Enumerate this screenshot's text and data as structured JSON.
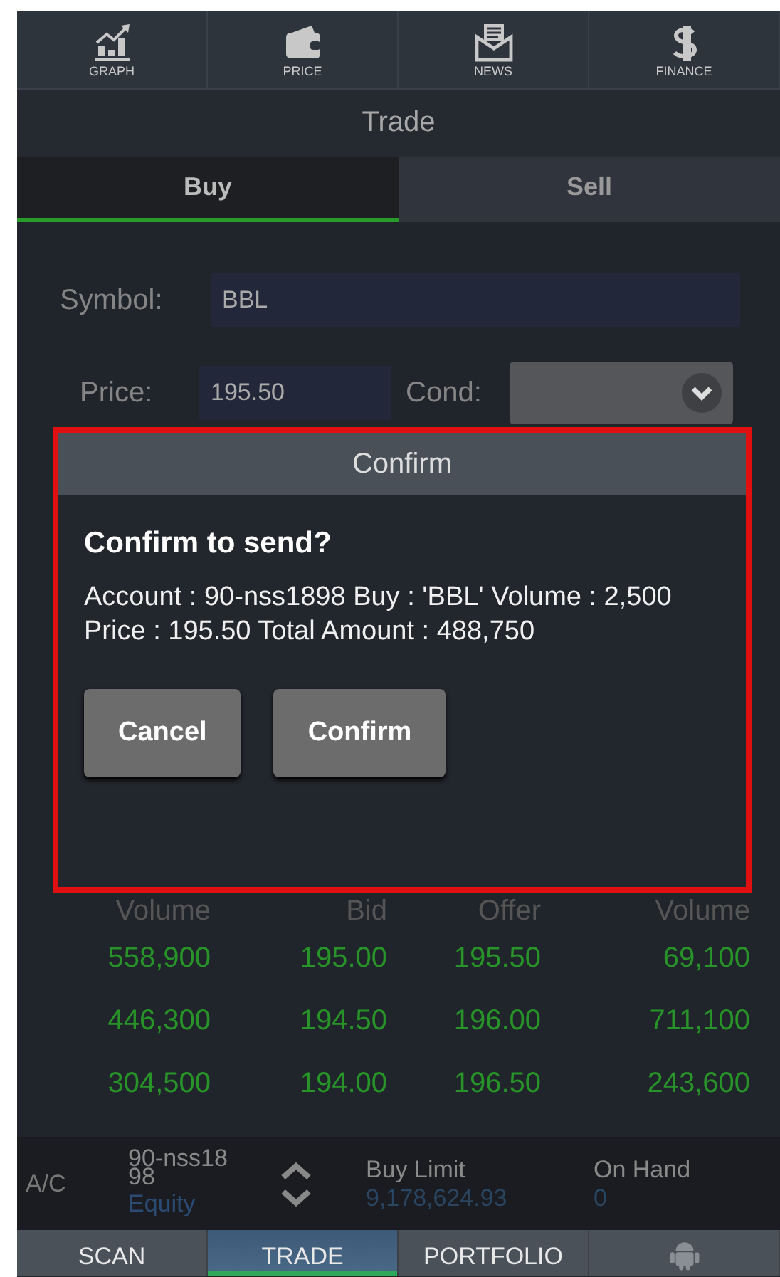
{
  "top_nav": [
    {
      "label": "GRAPH",
      "kind": "graph"
    },
    {
      "label": "PRICE",
      "kind": "wallet"
    },
    {
      "label": "NEWS",
      "kind": "mail"
    },
    {
      "label": "FINANCE",
      "kind": "dollar"
    }
  ],
  "title": "Trade",
  "tabs": [
    {
      "label": "Buy",
      "selected": true
    },
    {
      "label": "Sell",
      "selected": false
    }
  ],
  "form": {
    "symbol": {
      "label": "Symbol:",
      "value": "BBL"
    },
    "price": {
      "label": "Price:",
      "value": "195.50"
    },
    "condition": {
      "label": "Cond:"
    }
  },
  "dialog": {
    "title": "Confirm",
    "heading": "Confirm to send?",
    "message": "Account : 90-nss1898 Buy : 'BBL' Volume : 2,500 Price : 195.50 Total Amount : 488,750",
    "buttons": [
      "Cancel",
      "Confirm"
    ]
  },
  "order_book": {
    "columns": [
      "Volume",
      "Bid",
      "Offer",
      "Volume"
    ],
    "rows": [
      [
        "558,900",
        "195.00",
        "195.50",
        "69,100"
      ],
      [
        "446,300",
        "194.50",
        "196.00",
        "711,100"
      ],
      [
        "304,500",
        "194.00",
        "196.50",
        "243,600"
      ]
    ]
  },
  "account_bar": {
    "label": "A/C",
    "account": "90-nss1898",
    "type": "Equity",
    "buy_limit_label": "Buy Limit",
    "buy_limit": "9,178,624.93",
    "on_hand_label": "On Hand",
    "on_hand": "0"
  },
  "bottom_nav": [
    {
      "kind": "text",
      "label": "SCAN",
      "selected": false
    },
    {
      "kind": "text",
      "label": "TRADE",
      "selected": true
    },
    {
      "kind": "text",
      "label": "PORTFOLIO",
      "selected": false
    },
    {
      "kind": "robot",
      "selected": false
    }
  ]
}
